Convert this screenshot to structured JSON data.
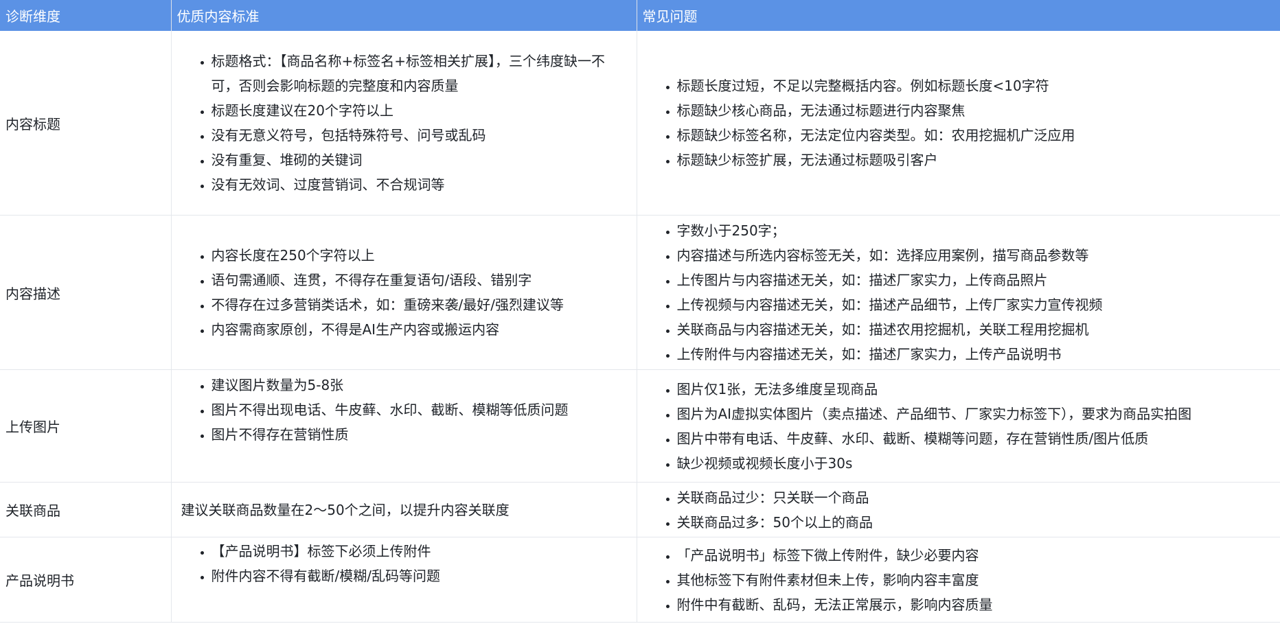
{
  "headers": [
    "诊断维度",
    "优质内容标准",
    "常见问题"
  ],
  "rows": [
    {
      "dimension": "内容标题",
      "standards": [
        "标题格式：【商品名称+标签名+标签相关扩展】，三个纬度缺一不可，否则会影响标题的完整度和内容质量",
        "标题长度建议在20个字符以上",
        "没有无意义符号，包括特殊符号、问号或乱码",
        "没有重复、堆砌的关键词",
        "没有无效词、过度营销词、不合规词等"
      ],
      "issues": [
        "标题长度过短，不足以完整概括内容。例如标题长度<10字符",
        "标题缺少核心商品，无法通过标题进行内容聚焦",
        "标题缺少标签名称，无法定位内容类型。如：农用挖掘机广泛应用",
        "标题缺少标签扩展，无法通过标题吸引客户"
      ]
    },
    {
      "dimension": "内容描述",
      "standards": [
        "内容长度在250个字符以上",
        "语句需通顺、连贯，不得存在重复语句/语段、错别字",
        "不得存在过多营销类话术，如：重磅来袭/最好/强烈建议等",
        "内容需商家原创，不得是AI生产内容或搬运内容"
      ],
      "issues": [
        "字数小于250字；",
        "内容描述与所选内容标签无关，如：选择应用案例，描写商品参数等",
        "上传图片与内容描述无关，如：描述厂家实力，上传商品照片",
        "上传视频与内容描述无关，如：描述产品细节，上传厂家实力宣传视频",
        "关联商品与内容描述无关，如：描述农用挖掘机，关联工程用挖掘机",
        "上传附件与内容描述无关，如：描述厂家实力，上传产品说明书"
      ]
    },
    {
      "dimension": "上传图片",
      "standards": [
        "建议图片数量为5-8张",
        "图片不得出现电话、牛皮藓、水印、截断、模糊等低质问题",
        "图片不得存在营销性质"
      ],
      "issues": [
        "图片仅1张，无法多维度呈现商品",
        "图片为AI虚拟实体图片（卖点描述、产品细节、厂家实力标签下），要求为商品实拍图",
        "图片中带有电话、牛皮藓、水印、截断、模糊等问题，存在营销性质/图片低质",
        "缺少视频或视频长度小于30s"
      ]
    },
    {
      "dimension": "关联商品",
      "standard_text": "建议关联商品数量在2～50个之间，以提升内容关联度",
      "issues": [
        "关联商品过少：只关联一个商品",
        "关联商品过多：50个以上的商品"
      ]
    },
    {
      "dimension": "产品说明书",
      "standards": [
        "【产品说明书】标签下必须上传附件",
        "附件内容不得有截断/模糊/乱码等问题"
      ],
      "issues": [
        "「产品说明书」标签下微上传附件，缺少必要内容",
        "其他标签下有附件素材但未上传，影响内容丰富度",
        "附件中有截断、乱码，无法正常展示，影响内容质量"
      ]
    }
  ]
}
